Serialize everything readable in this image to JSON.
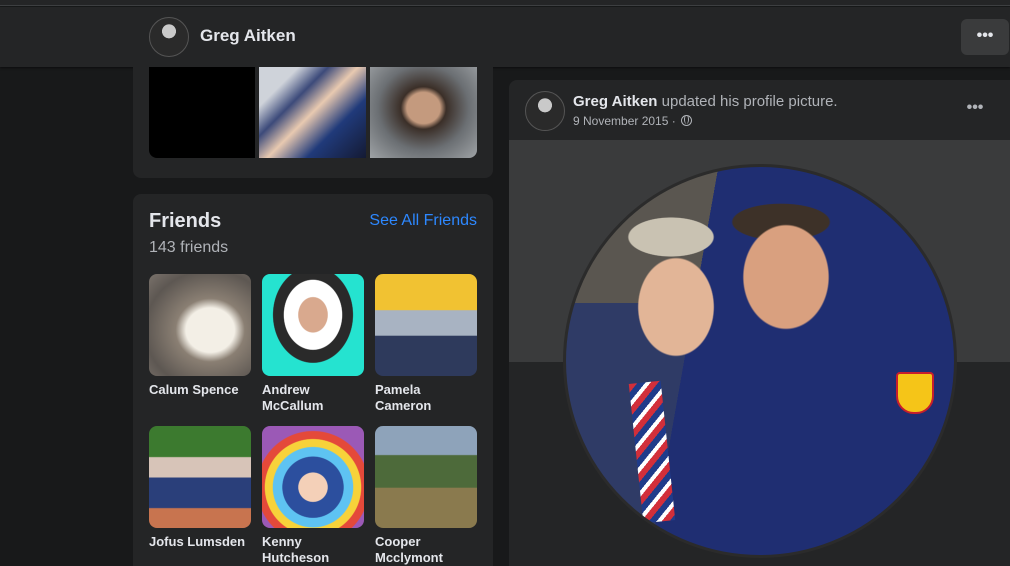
{
  "profile": {
    "name": "Greg Aitken",
    "more_label": "•••"
  },
  "photos": {
    "items": [
      {
        "icon": "photo-black"
      },
      {
        "icon": "photo-two-men"
      },
      {
        "icon": "photo-selfie"
      }
    ]
  },
  "friends": {
    "title": "Friends",
    "see_all": "See All Friends",
    "count": "143 friends",
    "items": [
      {
        "name": "Calum Spence"
      },
      {
        "name": "Andrew McCallum"
      },
      {
        "name": "Pamela Cameron"
      },
      {
        "name": "Jofus Lumsden"
      },
      {
        "name": "Kenny Hutcheson"
      },
      {
        "name": "Cooper Mcclymont"
      }
    ]
  },
  "post": {
    "author": "Greg Aitken",
    "action": " updated his profile picture.",
    "date": "9 November 2015",
    "separator": " · ",
    "more_label": "•••"
  }
}
